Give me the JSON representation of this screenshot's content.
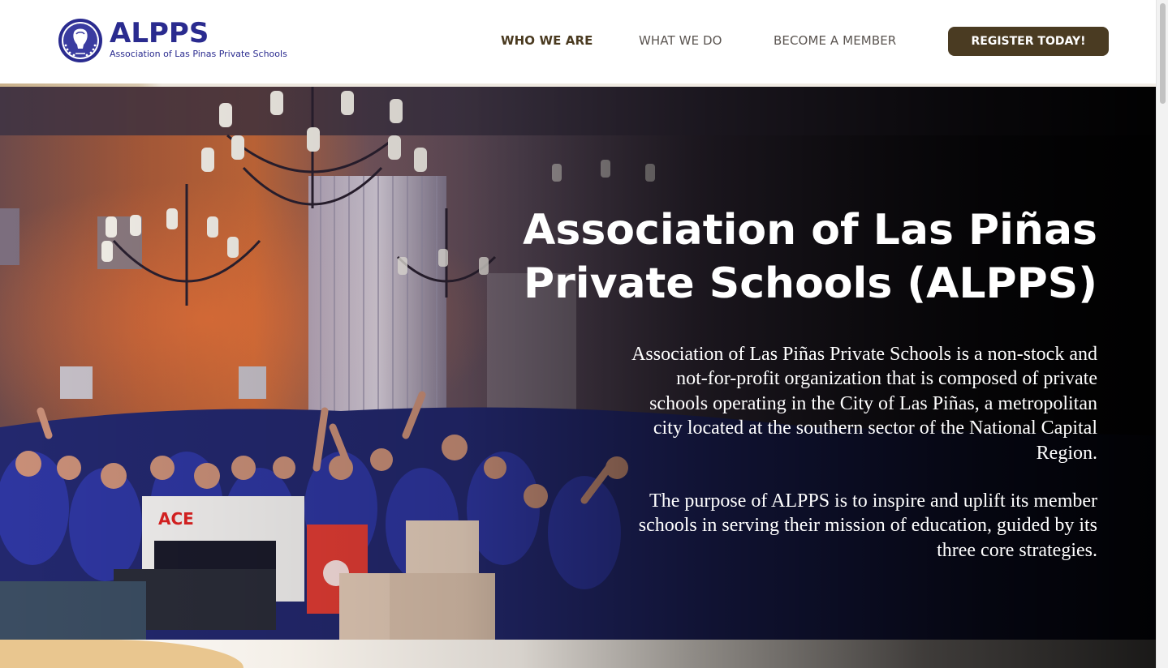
{
  "header": {
    "logo": {
      "title": "ALPPS",
      "subtitle": "Association of Las Pinas Private Schools"
    },
    "nav": [
      {
        "label": "WHO WE ARE",
        "active": true
      },
      {
        "label": "WHAT WE DO",
        "active": false
      },
      {
        "label": "BECOME A MEMBER",
        "active": false
      }
    ],
    "cta_label": "REGISTER TODAY!"
  },
  "hero": {
    "title": "Association of Las Piñas Private Schools (ALPPS)",
    "paragraph_1": "Association of Las Piñas Private Schools is a non-stock and not-for-profit organization that is composed of private schools operating in the City of Las Piñas, a metropolitan city located at the southern sector of the National Capital Region.",
    "paragraph_2": "The purpose of ALPPS is to inspire and uplift its member schools in serving their mission of education, guided by its three core strategies.",
    "image_description_icon": "event-hall-photo"
  },
  "colors": {
    "brand_blue": "#2a2b8f",
    "nav_active": "#4a3a20",
    "nav_default": "#5a5450",
    "cta_background": "#4a3b22",
    "accent_gold": "#e9c68f",
    "hero_text": "#ffffff"
  }
}
